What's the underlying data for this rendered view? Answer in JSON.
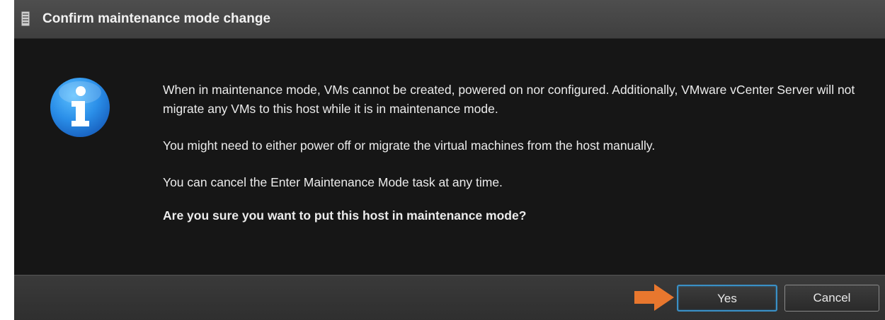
{
  "dialog": {
    "title": "Confirm maintenance mode change",
    "title_icon": "server-icon",
    "info_icon": "info-icon",
    "message": {
      "paragraph1": "When in maintenance mode, VMs cannot be created, powered on nor configured. Additionally, VMware vCenter Server will not migrate any VMs to this host while it is in maintenance mode.",
      "paragraph2": "You might need to either power off or migrate the virtual machines from the host manually.",
      "paragraph3": "You can cancel the Enter Maintenance Mode task at any time.",
      "question": "Are you sure you want to put this host in maintenance mode?"
    },
    "buttons": {
      "yes_label": "Yes",
      "cancel_label": "Cancel"
    },
    "highlight_arrow_color": "#e8772e",
    "accent_color": "#3a90c6"
  }
}
